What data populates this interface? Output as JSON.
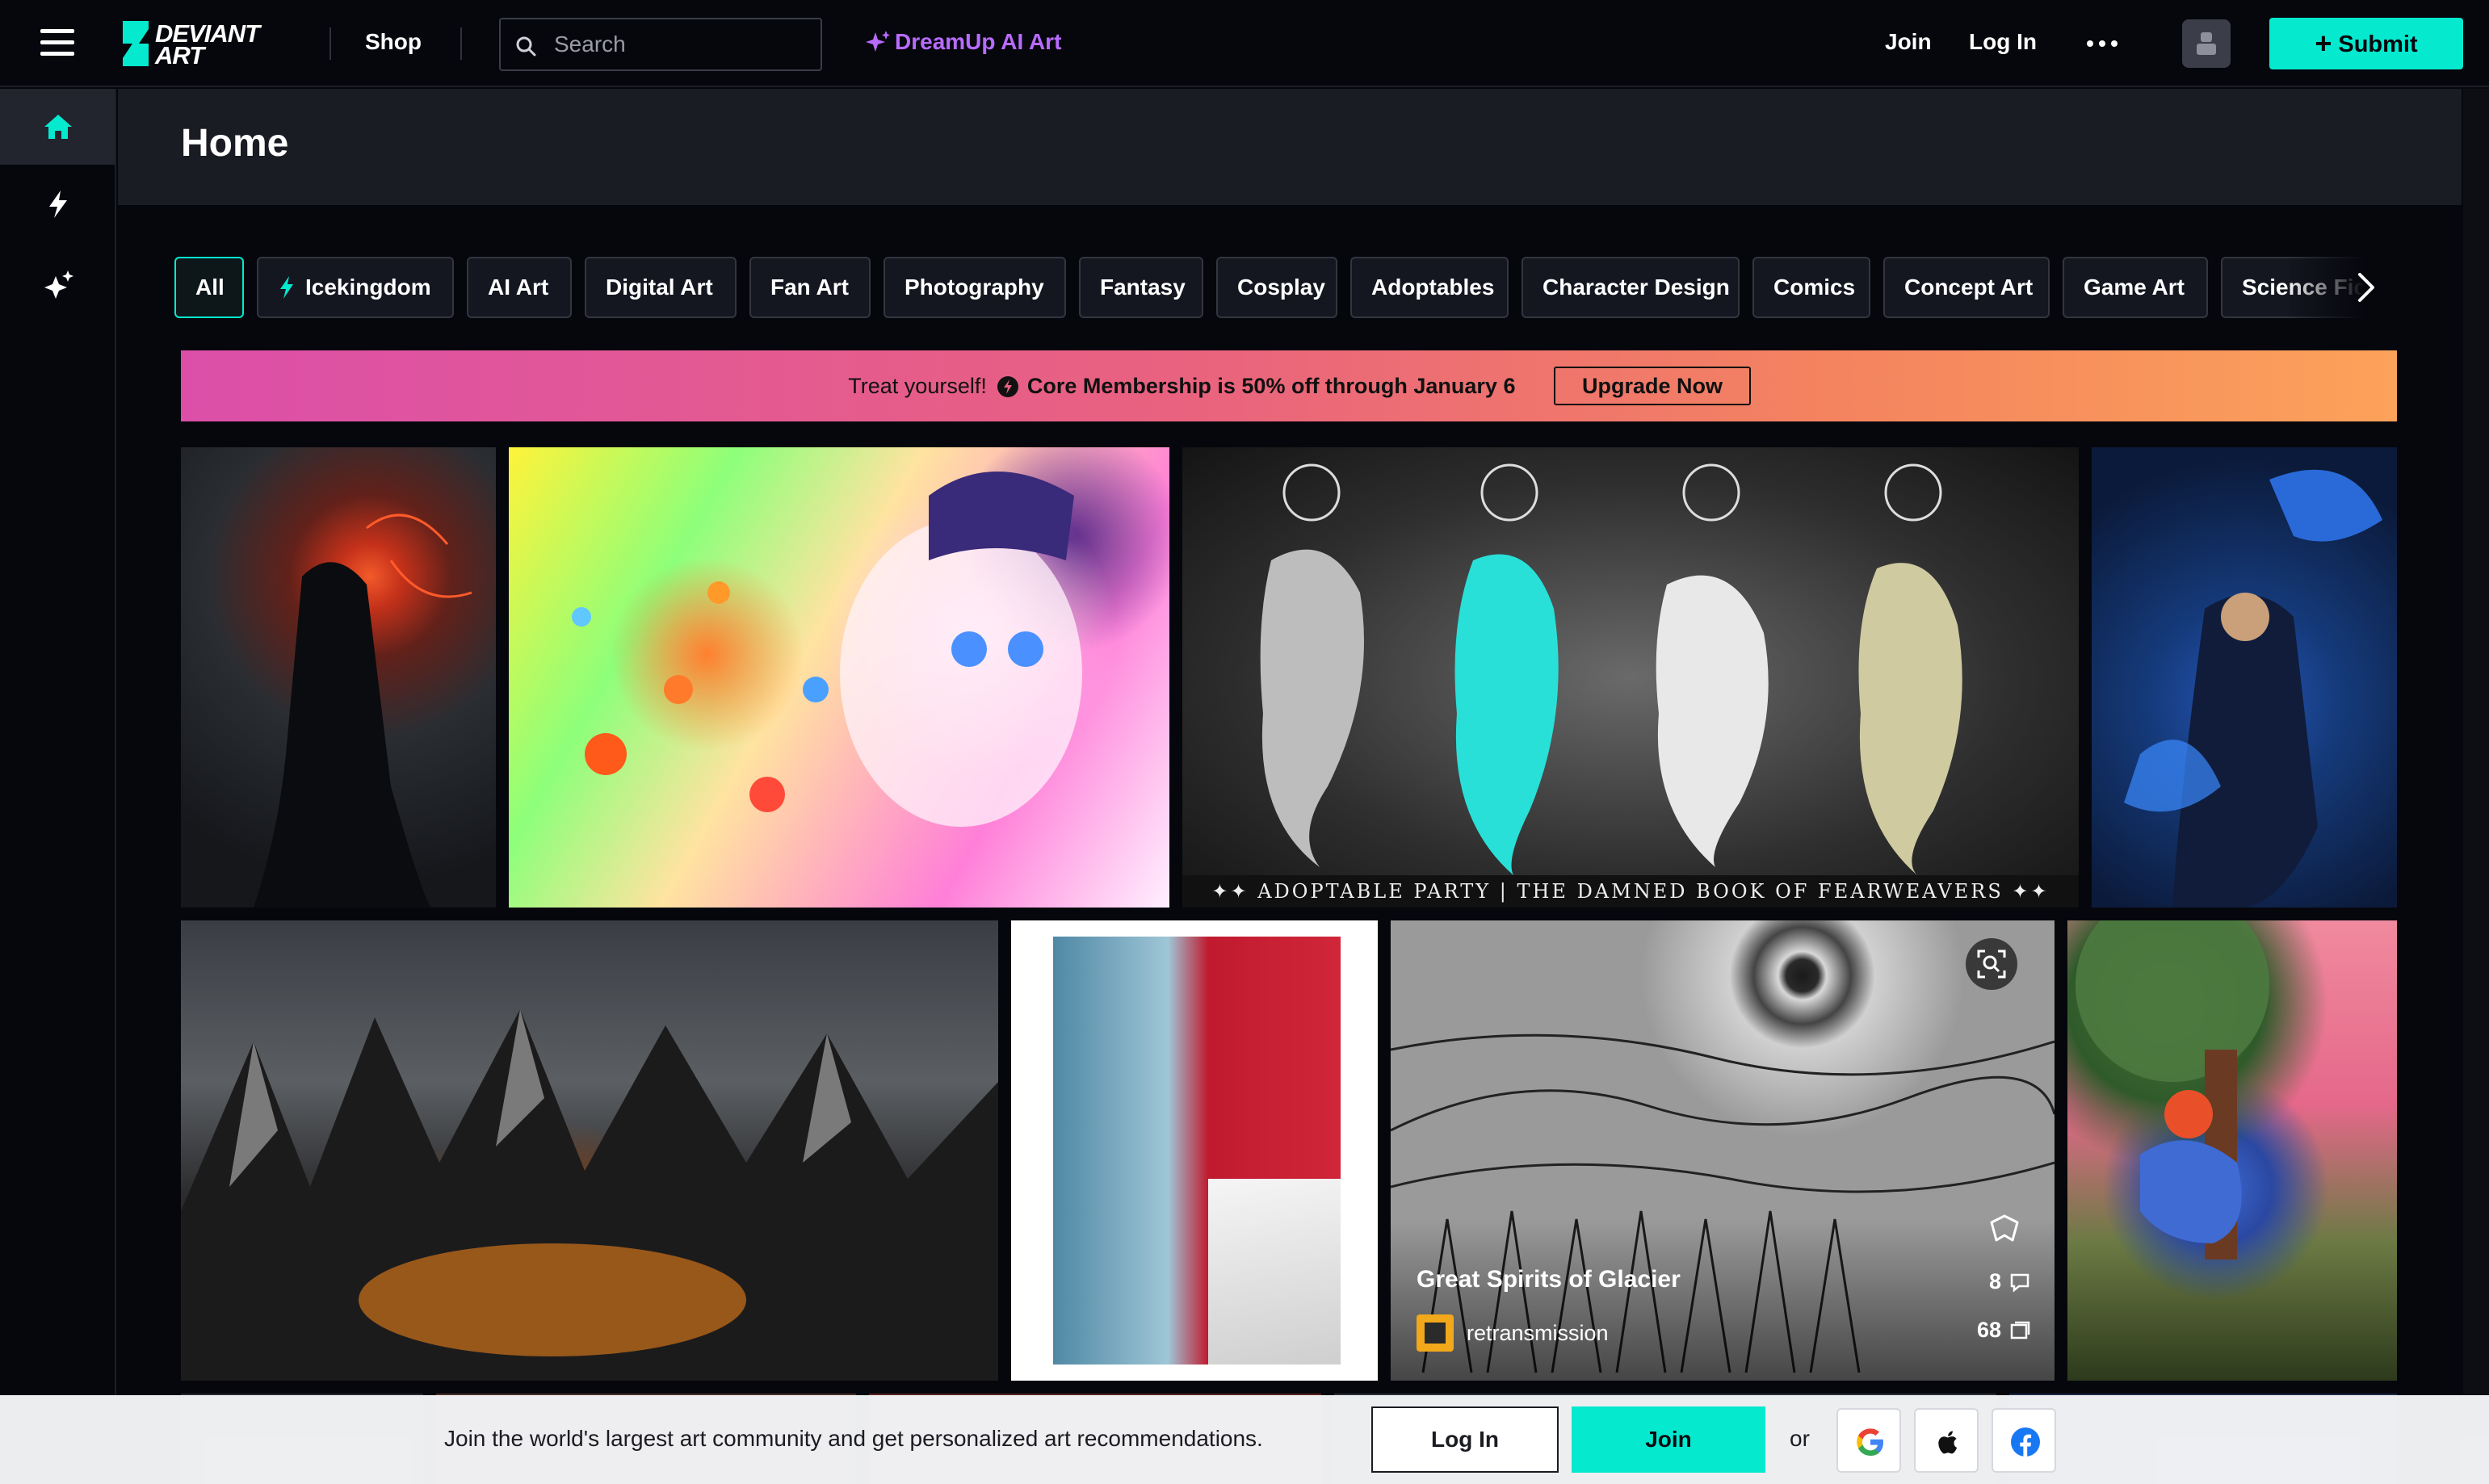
{
  "brand": {
    "name_line1": "DEVIANT",
    "name_line2": "ART",
    "accent": "#05e9cf",
    "ai_purple": "#b86bff"
  },
  "topbar": {
    "shop": "Shop",
    "search_placeholder": "Search",
    "dreamup": "DreamUp AI Art",
    "join": "Join",
    "login": "Log In",
    "submit": "Submit"
  },
  "rail": {
    "items": [
      {
        "icon": "home-icon",
        "active": true
      },
      {
        "icon": "lightning-icon",
        "active": false
      },
      {
        "icon": "dreamup-sparkle-icon",
        "active": false
      }
    ]
  },
  "page": {
    "title": "Home"
  },
  "chips": [
    {
      "label": "All",
      "active": true
    },
    {
      "label": "Icekingdom",
      "icon": "lightning-icon"
    },
    {
      "label": "AI Art"
    },
    {
      "label": "Digital Art"
    },
    {
      "label": "Fan Art"
    },
    {
      "label": "Photography"
    },
    {
      "label": "Fantasy"
    },
    {
      "label": "Cosplay"
    },
    {
      "label": "Adoptables"
    },
    {
      "label": "Character Design"
    },
    {
      "label": "Comics"
    },
    {
      "label": "Concept Art"
    },
    {
      "label": "Game Art"
    },
    {
      "label": "Science Fiction"
    }
  ],
  "promo": {
    "treat": "Treat yourself!",
    "deal": "Core Membership is 50% off through January 6",
    "cta": "Upgrade Now"
  },
  "gallery": {
    "featured": {
      "title": "Great Spirits of Glacier",
      "author": "retransmission",
      "comments": "8",
      "favourites": "68"
    },
    "adoptable_caption": "✦✦ ADOPTABLE PARTY | THE DAMNED BOOK OF FEARWEAVERS ✦✦"
  },
  "signup": {
    "message": "Join the world's largest art community and get personalized art recommendations.",
    "login": "Log In",
    "join": "Join",
    "or": "or"
  }
}
